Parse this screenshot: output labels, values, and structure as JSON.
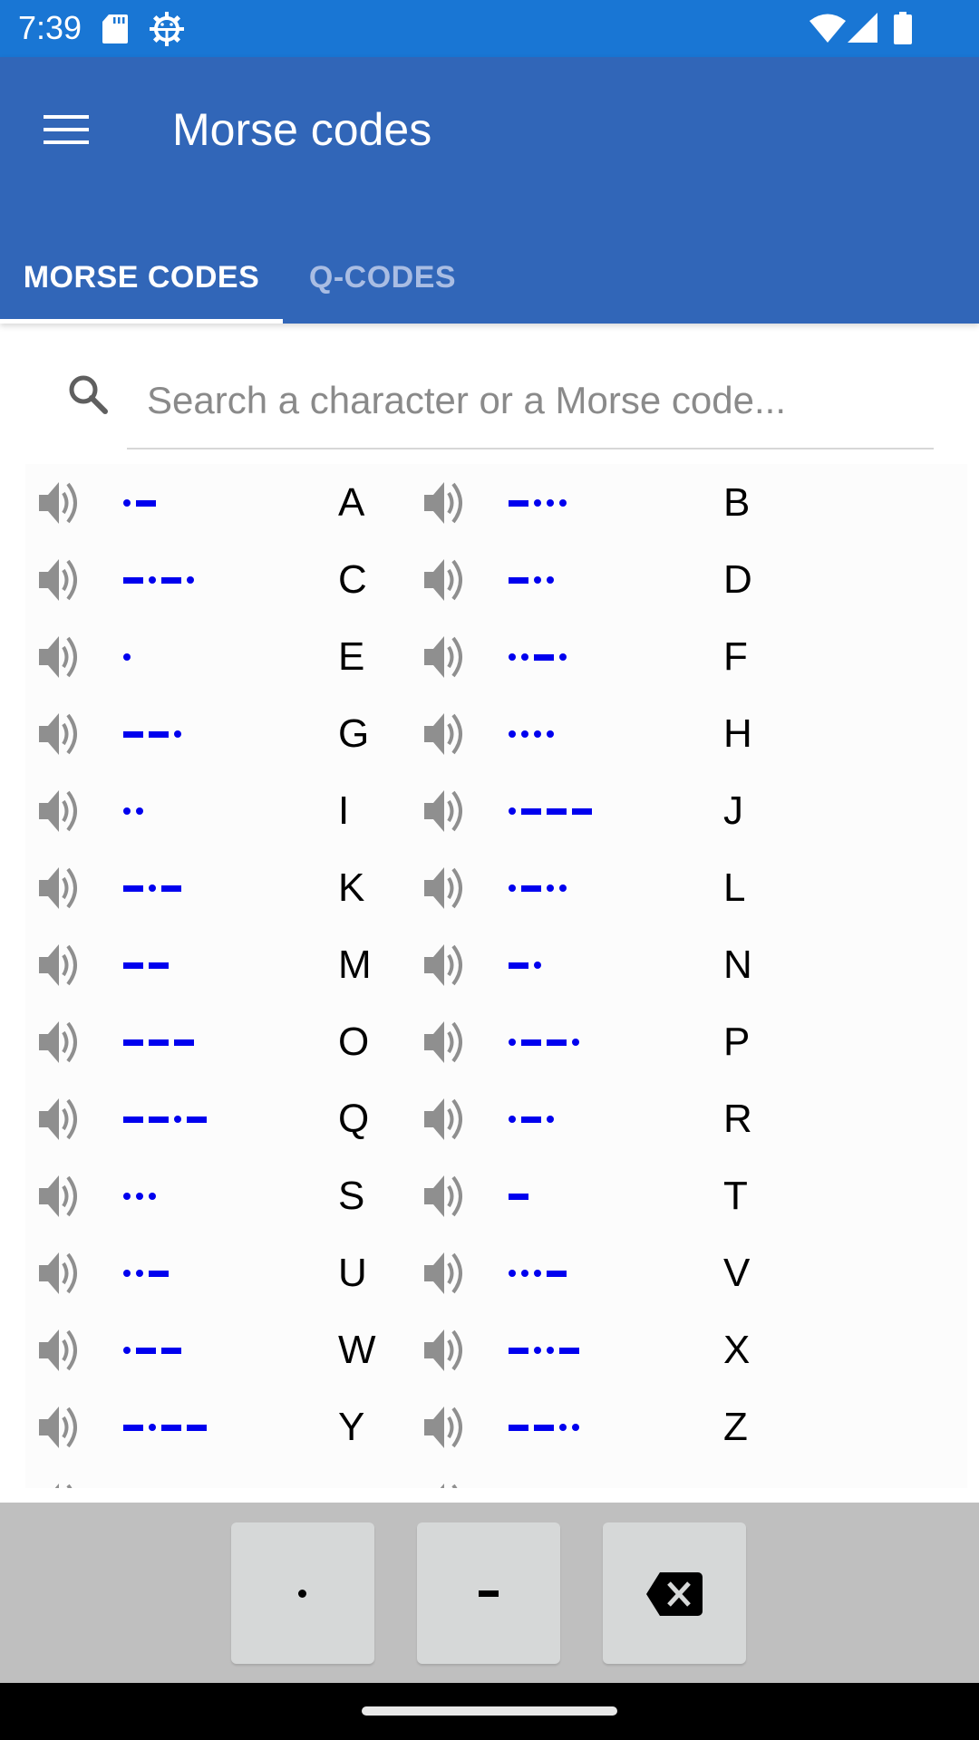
{
  "status_bar": {
    "time": "7:39",
    "left_icons": [
      "sd-card-icon",
      "android-debug-icon"
    ],
    "right_icons": [
      "wifi-icon",
      "cell-signal-icon",
      "battery-icon"
    ]
  },
  "app_bar": {
    "menu_icon": "hamburger-menu-icon",
    "title": "Morse codes"
  },
  "tabs": [
    {
      "label": "MORSE CODES",
      "selected": true
    },
    {
      "label": "Q-CODES",
      "selected": false
    }
  ],
  "search": {
    "icon": "search-icon",
    "value": "",
    "placeholder": "Search a character or a Morse code..."
  },
  "codes": [
    {
      "char": "A",
      "code": ".-"
    },
    {
      "char": "B",
      "code": "-..."
    },
    {
      "char": "C",
      "code": "-.-."
    },
    {
      "char": "D",
      "code": "-.."
    },
    {
      "char": "E",
      "code": "."
    },
    {
      "char": "F",
      "code": "..-."
    },
    {
      "char": "G",
      "code": "--."
    },
    {
      "char": "H",
      "code": "...."
    },
    {
      "char": "I",
      "code": ".."
    },
    {
      "char": "J",
      "code": ".---"
    },
    {
      "char": "K",
      "code": "-.-"
    },
    {
      "char": "L",
      "code": ".-.."
    },
    {
      "char": "M",
      "code": "--"
    },
    {
      "char": "N",
      "code": "-."
    },
    {
      "char": "O",
      "code": "---"
    },
    {
      "char": "P",
      "code": ".--."
    },
    {
      "char": "Q",
      "code": "--.-"
    },
    {
      "char": "R",
      "code": ".-."
    },
    {
      "char": "S",
      "code": "..."
    },
    {
      "char": "T",
      "code": "-"
    },
    {
      "char": "U",
      "code": "..-"
    },
    {
      "char": "V",
      "code": "...-"
    },
    {
      "char": "W",
      "code": ".--"
    },
    {
      "char": "X",
      "code": "-..-"
    },
    {
      "char": "Y",
      "code": "-.--"
    },
    {
      "char": "Z",
      "code": "--.."
    }
  ],
  "keyboard": {
    "keys": [
      {
        "name": "dot-key",
        "value": "."
      },
      {
        "name": "dash-key",
        "value": "-"
      },
      {
        "name": "backspace-key",
        "icon": "backspace-icon"
      }
    ]
  },
  "colors": {
    "status_bar": "#1976d4",
    "app_bar": "#3166b8",
    "morse_symbol": "#0000ee",
    "tab_inactive": "#a9bde3",
    "speaker_icon": "#8f8f8f",
    "keyboard_bg": "#bfbfbf",
    "key_bg": "#d6d8d8"
  }
}
